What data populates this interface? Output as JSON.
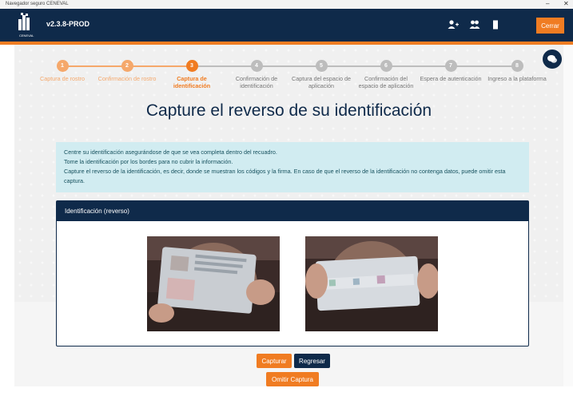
{
  "window": {
    "title": "Navegador seguro CENEVAL",
    "controls": [
      "–",
      "✕"
    ]
  },
  "header": {
    "logo_text": "CENEVAL",
    "version": "v2.3.8-PROD",
    "icons": [
      "user-add-icon",
      "users-icon",
      "document-icon"
    ],
    "close_label": "Cerrar"
  },
  "colors": {
    "navy": "#0f2a4a",
    "orange": "#f07c22",
    "info_bg": "#d1ecf1"
  },
  "steps": [
    {
      "n": "1",
      "label": "Captura de rostro",
      "state": "done"
    },
    {
      "n": "2",
      "label": "Confirmación de rostro",
      "state": "done"
    },
    {
      "n": "3",
      "label": "Captura de identificación",
      "state": "active"
    },
    {
      "n": "4",
      "label": "Confirmación de identificación",
      "state": "todo"
    },
    {
      "n": "5",
      "label": "Captura del espacio de aplicación",
      "state": "todo"
    },
    {
      "n": "6",
      "label": "Confirmación del espacio de aplicación",
      "state": "todo"
    },
    {
      "n": "7",
      "label": "Espera de autenticación",
      "state": "todo"
    },
    {
      "n": "8",
      "label": "Ingreso a la plataforma",
      "state": "todo"
    }
  ],
  "main": {
    "title": "Capture el reverso de su identificación",
    "info": [
      "Centre su identificación asegurándose de que se vea completa dentro del recuadro.",
      "Tome la identificación por los bordes para no cubrir la información.",
      "Capture el reverso de la identificación, es decir, donde se muestran los códigos y la firma. En caso de que el reverso de la identificación no contenga datos, puede omitir esta captura."
    ],
    "card_title": "Identificación (reverso)"
  },
  "buttons": {
    "capture": "Capturar",
    "back": "Regresar",
    "skip": "Omitir Captura"
  }
}
